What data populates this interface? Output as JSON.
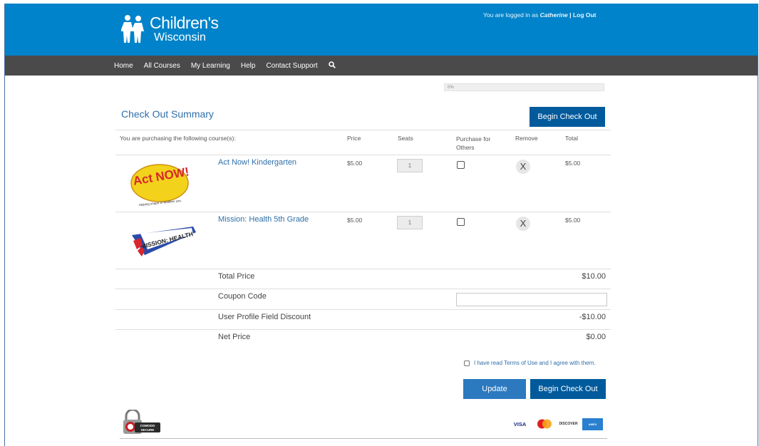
{
  "header": {
    "logo_line1": "Children's",
    "logo_line2": "Wisconsin",
    "login_prefix": "You are logged in as",
    "user": "Catherine",
    "separator": "|",
    "logout": "Log Out"
  },
  "nav": {
    "items": [
      "Home",
      "All Courses",
      "My Learning",
      "Help",
      "Contact Support"
    ],
    "search_icon": "search-icon"
  },
  "progress": {
    "text": "0%",
    "value": 0
  },
  "summary": {
    "title": "Check Out Summary",
    "begin_checkout_label": "Begin Check Out"
  },
  "table": {
    "headers": {
      "course": "You are purchasing the following course(s):",
      "price": "Price",
      "seats": "Seats",
      "purchase_for_others": "Purchase for Others",
      "remove": "Remove",
      "total": "Total"
    },
    "rows": [
      {
        "name": "Act Now! Kindergarten",
        "price": "$5.00",
        "seats": "1",
        "total": "$5.00",
        "remove": "X",
        "thumb_text": "Act NOW!",
        "thumb_caption": "Helping shape a healthier you."
      },
      {
        "name": "Mission: Health 5th Grade",
        "price": "$5.00",
        "seats": "1",
        "total": "$5.00",
        "remove": "X",
        "thumb_text": "MISSION: HEALTH"
      }
    ]
  },
  "totals": {
    "total_price_label": "Total Price",
    "total_price": "$10.00",
    "coupon_label": "Coupon Code",
    "coupon_value": "",
    "discount_label": "User Profile Field Discount",
    "discount": "-$10.00",
    "net_label": "Net Price",
    "net": "$0.00"
  },
  "terms": {
    "text": "I have read Terms of Use and I agree with them."
  },
  "actions": {
    "update": "Update",
    "begin_checkout": "Begin Check Out"
  },
  "footer": {
    "seal_line1": "COMODO",
    "seal_line2": "SECURE",
    "cards": [
      "VISA",
      "MASTERCARD",
      "DISCOVER",
      "AMERICAN EXPRESS"
    ]
  },
  "colors": {
    "header_blue": "#0083ca",
    "nav_gray": "#4a4a4a",
    "button_blue": "#005a9c",
    "link_blue": "#2f6fa8"
  }
}
